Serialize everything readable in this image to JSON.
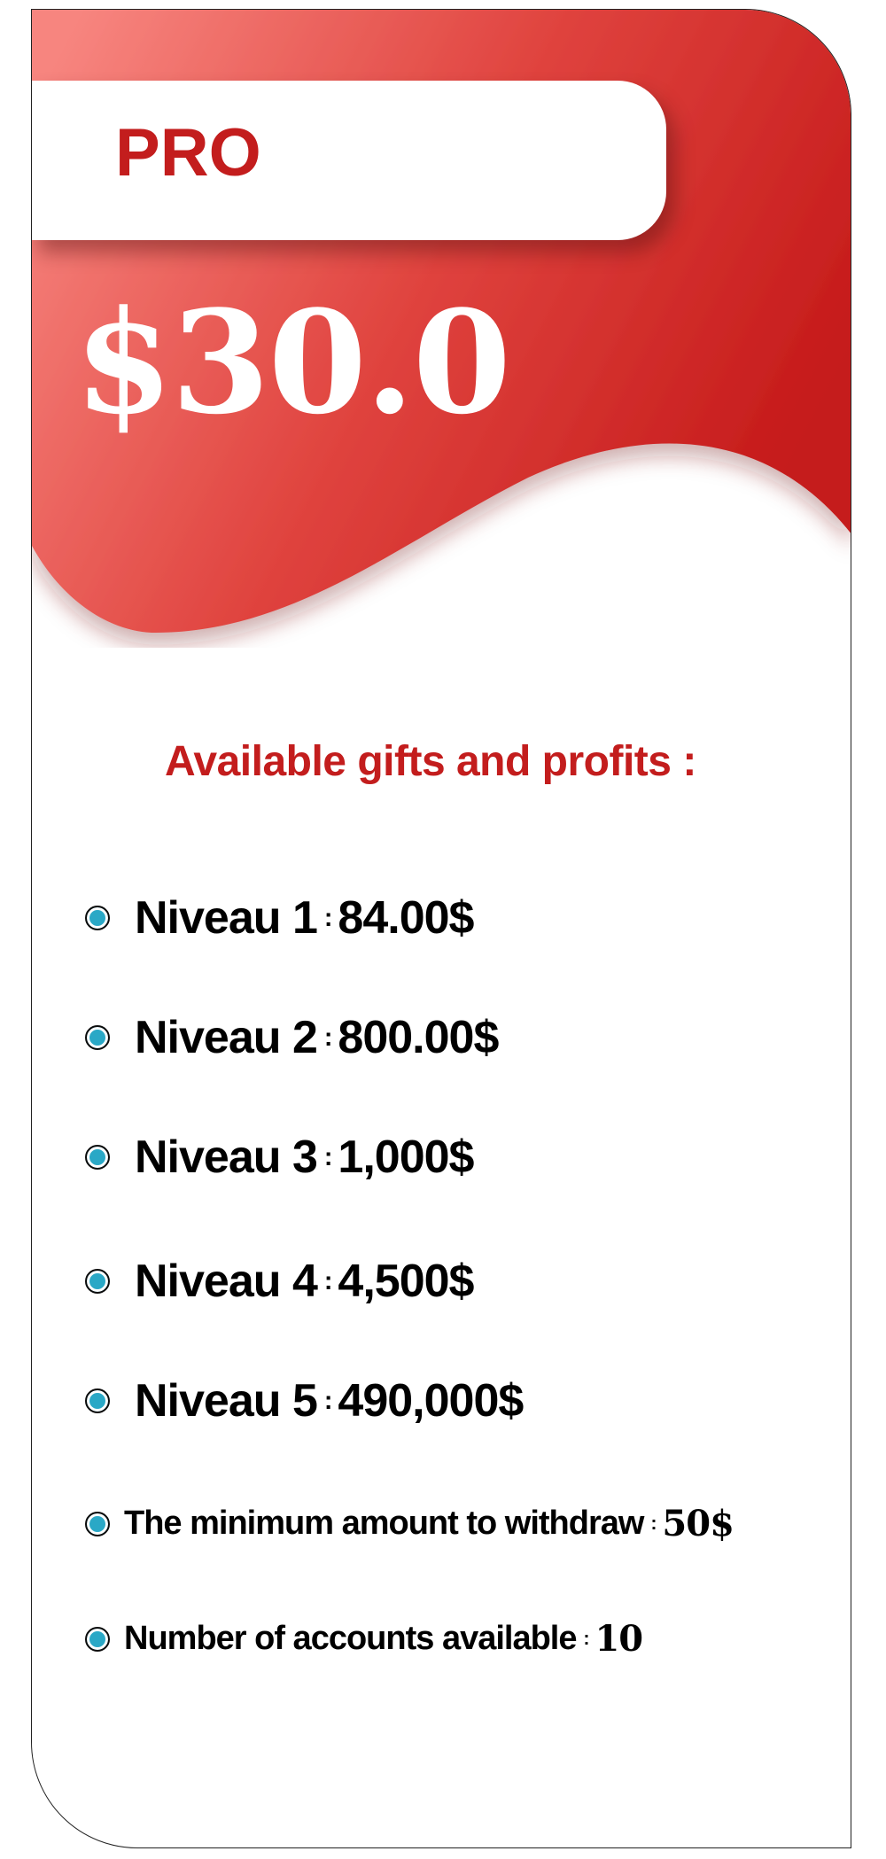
{
  "plan": {
    "name": "PRO",
    "price": "$30.0"
  },
  "colors": {
    "accent": "#c31d1d",
    "gradient_light": "#f7857f",
    "gradient_dark": "#c51a1a",
    "bullet": "#2aa8c6"
  },
  "section_title": "Available gifts and profits :",
  "features": [
    {
      "label": "Niveau 1",
      "value": "84.00$"
    },
    {
      "label": "Niveau 2",
      "value": "800.00$"
    },
    {
      "label": "Niveau 3",
      "value": "1,000$"
    },
    {
      "label": "Niveau 4",
      "value": "4,500$"
    },
    {
      "label": "Niveau 5",
      "value": "490,000$"
    },
    {
      "label": "The minimum amount to withdraw",
      "value": "50$"
    },
    {
      "label": "Number of accounts available",
      "value": "10"
    }
  ]
}
